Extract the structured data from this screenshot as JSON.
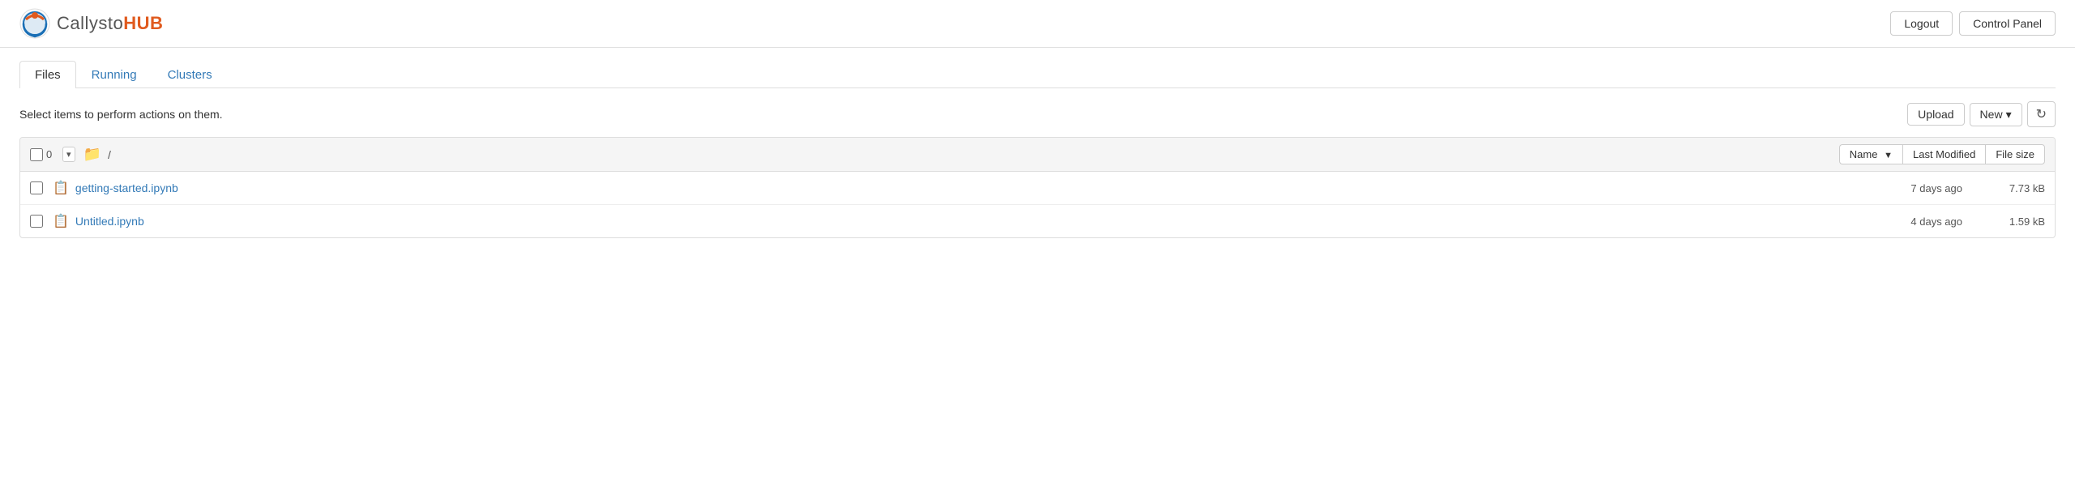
{
  "header": {
    "logo_callysto": "Callysto",
    "logo_hub": "HUB",
    "logout_label": "Logout",
    "control_panel_label": "Control Panel"
  },
  "tabs": [
    {
      "id": "files",
      "label": "Files",
      "active": true
    },
    {
      "id": "running",
      "label": "Running",
      "active": false
    },
    {
      "id": "clusters",
      "label": "Clusters",
      "active": false
    }
  ],
  "toolbar": {
    "select_text": "Select items to perform actions on them.",
    "upload_label": "Upload",
    "new_label": "New",
    "refresh_label": "↻"
  },
  "file_list": {
    "count": "0",
    "breadcrumb": "/",
    "columns": {
      "name": "Name",
      "last_modified": "Last Modified",
      "file_size": "File size"
    },
    "files": [
      {
        "name": "getting-started.ipynb",
        "date": "7 days ago",
        "size": "7.73 kB"
      },
      {
        "name": "Untitled.ipynb",
        "date": "4 days ago",
        "size": "1.59 kB"
      }
    ]
  }
}
